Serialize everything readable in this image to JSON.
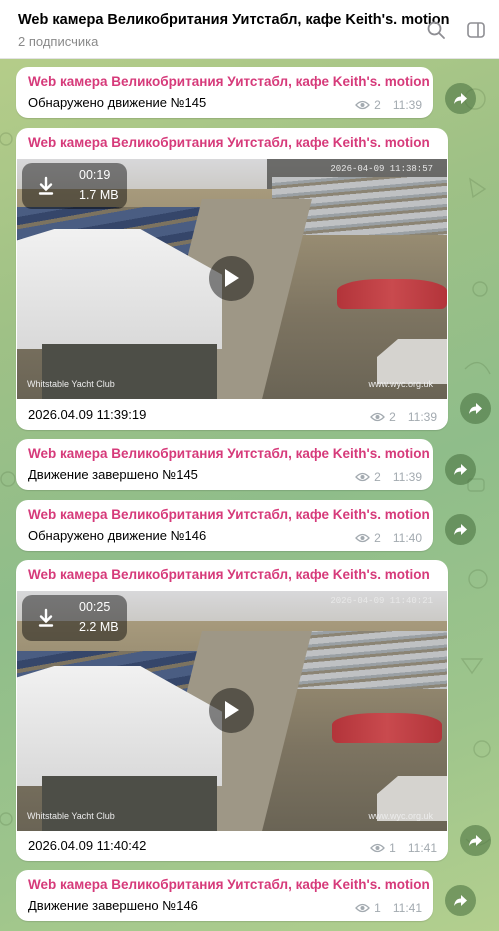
{
  "header": {
    "title": "Web камера Великобритания Уитстабл, кафе Keith's. motion",
    "subtitle": "2 подписчика"
  },
  "messages": [
    {
      "author": "Web камера Великобритания Уитстабл, кафе Keith's. motion",
      "text": "Обнаружено движение №145",
      "views": "2",
      "time": "11:39"
    },
    {
      "author": "Web камера Великобритания Уитстабл, кафе Keith's. motion",
      "caption": "2026.04.09 11:39:19",
      "views": "2",
      "time": "11:39",
      "video": {
        "duration": "00:19",
        "size": "1.7 MB",
        "stamp": "2026-04-09 11:38:57",
        "cam_name": "Whitstable Yacht Club",
        "cam_url": "www.wyc.org.uk"
      }
    },
    {
      "author": "Web камера Великобритания Уитстабл, кафе Keith's. motion",
      "text": "Движение завершено №145",
      "views": "2",
      "time": "11:39"
    },
    {
      "author": "Web камера Великобритания Уитстабл, кафе Keith's. motion",
      "text": "Обнаружено движение №146",
      "views": "2",
      "time": "11:40"
    },
    {
      "author": "Web камера Великобритания Уитстабл, кафе Keith's. motion",
      "caption": "2026.04.09 11:40:42",
      "views": "1",
      "time": "11:41",
      "video": {
        "duration": "00:25",
        "size": "2.2 MB",
        "stamp": "2026-04-09 11:40:21",
        "cam_name": "Whitstable Yacht Club",
        "cam_url": "www.wyc.org.uk"
      }
    },
    {
      "author": "Web камера Великобритания Уитстабл, кафе Keith's. motion",
      "text": "Движение завершено №146",
      "views": "1",
      "time": "11:41"
    }
  ],
  "icons": {
    "search": "search-icon",
    "sidebar": "sidebar-toggle-icon",
    "views": "eye-icon",
    "share": "share-icon",
    "download": "download-icon",
    "play": "play-icon"
  },
  "colors": {
    "author": "#d63a7a",
    "meta": "#a3aab0"
  }
}
